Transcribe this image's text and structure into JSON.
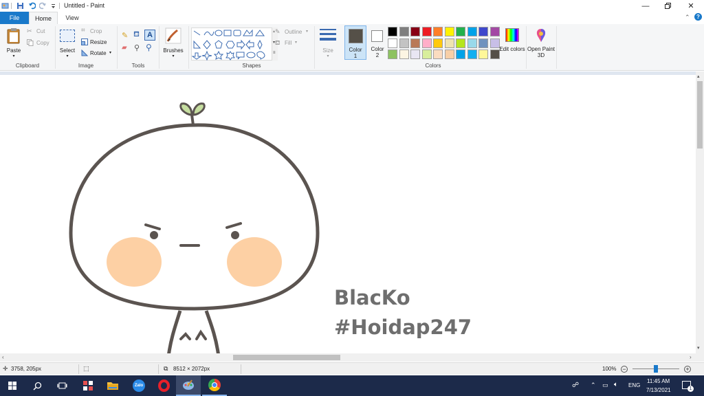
{
  "window": {
    "title": "Untitled - Paint",
    "controls": [
      "minimize-icon",
      "restore-icon",
      "close-icon"
    ]
  },
  "tabs": {
    "file": "File",
    "home": "Home",
    "view": "View"
  },
  "ribbon": {
    "clipboard": {
      "label": "Clipboard",
      "paste": "Paste",
      "cut": "Cut",
      "copy": "Copy"
    },
    "image": {
      "label": "Image",
      "select": "Select",
      "crop": "Crop",
      "resize": "Resize",
      "rotate": "Rotate"
    },
    "tools": {
      "label": "Tools"
    },
    "brushes": {
      "label": "Brushes"
    },
    "shapes": {
      "label": "Shapes",
      "outline": "Outline",
      "fill": "Fill"
    },
    "size": {
      "label": "Size"
    },
    "color1": {
      "label": "Color",
      "num": "1",
      "value": "#555048"
    },
    "color2": {
      "label": "Color",
      "num": "2",
      "value": "#ffffff"
    },
    "colors": {
      "label": "Colors",
      "row1": [
        "#000000",
        "#7f7f7f",
        "#880015",
        "#ed1c24",
        "#ff7f27",
        "#fff200",
        "#22b14c",
        "#00a2e8",
        "#3f48cc",
        "#a349a4"
      ],
      "row2": [
        "#ffffff",
        "#c3c3c3",
        "#b97a57",
        "#ffaec9",
        "#ffc90e",
        "#efe4b0",
        "#b5e61d",
        "#99d9ea",
        "#7092be",
        "#c8bfe7"
      ],
      "row3": [
        "#8dc261",
        "#fcf5e3",
        "#e9e6f3",
        "#d8ee9c",
        "#fbdcc0",
        "#f7cfa7",
        "#00a2e8",
        "#14aff0",
        "#fff799",
        "#555048"
      ]
    },
    "edit_colors": "Edit colors",
    "open_paint3d": "Open Paint 3D"
  },
  "canvas": {
    "watermark_line1": "BlacKo",
    "watermark_line2": "#Hoidap247"
  },
  "status": {
    "cursor_pos": "3758, 205px",
    "image_size": "8512 × 2072px",
    "zoom": "100%",
    "zoom_level": 0.5
  },
  "taskbar": {
    "language": "ENG",
    "time": "11:45 AM",
    "date": "7/13/2021",
    "notification_count": "1"
  }
}
